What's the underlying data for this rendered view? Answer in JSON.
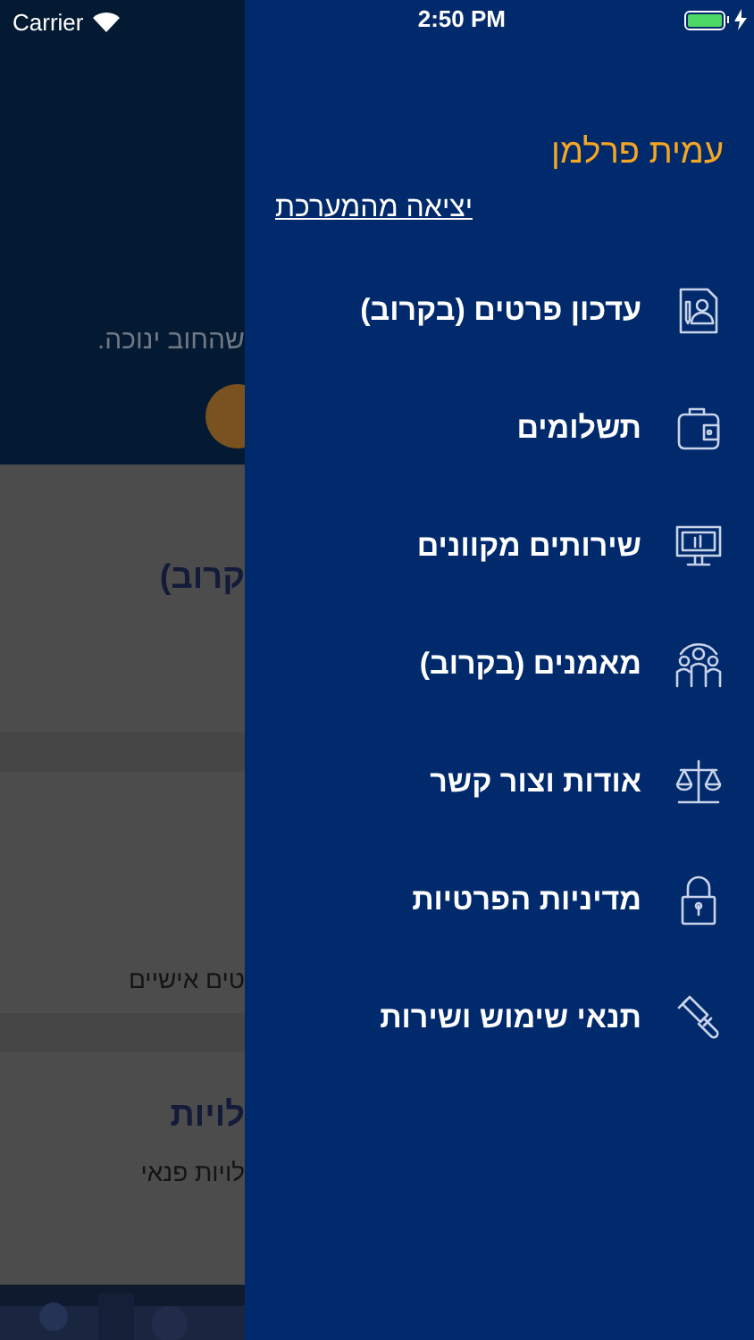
{
  "status_bar": {
    "carrier": "Carrier",
    "time": "2:50 PM"
  },
  "background": {
    "header_lines": [
      "שהחוב ינוכה."
    ],
    "cards": [
      {
        "title": "קרוב)"
      },
      {
        "text": "טים אישיים"
      },
      {
        "title": "לויות",
        "text": "לויות פנאי"
      }
    ]
  },
  "drawer": {
    "user_name": "עמית פרלמן",
    "logout": "יציאה מהמערכת",
    "items": [
      {
        "kind": "document",
        "label": "עדכון פרטים (בקרוב)"
      },
      {
        "kind": "wallet",
        "label": "תשלומים"
      },
      {
        "kind": "monitor",
        "label": "שירותים מקוונים"
      },
      {
        "kind": "people",
        "label": "מאמנים (בקרוב)"
      },
      {
        "kind": "scales",
        "label": "אודות וצור קשר"
      },
      {
        "kind": "lock",
        "label": "מדיניות הפרטיות"
      },
      {
        "kind": "gavel",
        "label": "תנאי שימוש ושירות"
      }
    ]
  }
}
